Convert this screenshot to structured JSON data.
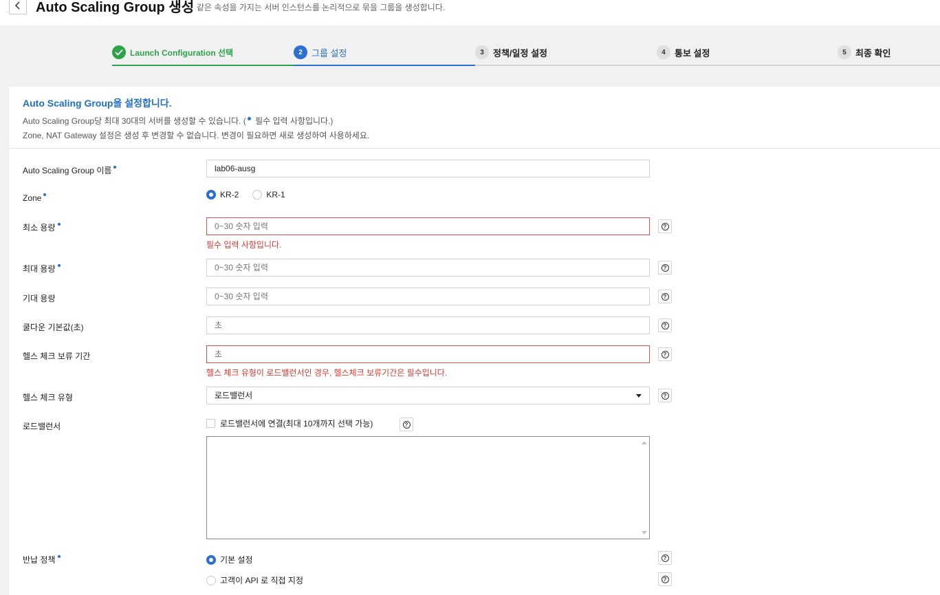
{
  "header": {
    "title": "Auto Scaling Group 생성",
    "description": "같은 속성을 가지는 서버 인스턴스를 논리적으로 묶을 그룹을 생성합니다."
  },
  "steps": [
    {
      "num": "",
      "label": "Launch Configuration 선택",
      "state": "done"
    },
    {
      "num": "2",
      "label": "그룹 설정",
      "state": "active"
    },
    {
      "num": "3",
      "label": "정책/일정 설정",
      "state": "todo"
    },
    {
      "num": "4",
      "label": "통보 설정",
      "state": "todo"
    },
    {
      "num": "5",
      "label": "최종 확인",
      "state": "todo"
    }
  ],
  "intro": {
    "title": "Auto Scaling Group을 설정합니다.",
    "line1_a": "Auto Scaling Group당 최대 30대의 서버를 생성할 수 있습니다. (",
    "line1_b": " 필수 입력 사항입니다.)",
    "line2": "Zone, NAT Gateway 설정은 생성 후 변경할 수 없습니다. 변경이 필요하면 새로 생성하여 사용하세요."
  },
  "form": {
    "name": {
      "label": "Auto Scaling Group 이름",
      "value": "lab06-ausg"
    },
    "zone": {
      "label": "Zone",
      "options": [
        "KR-2",
        "KR-1"
      ],
      "selected": "KR-2"
    },
    "min_capacity": {
      "label": "최소 용량",
      "placeholder": "0~30 숫자 입력",
      "error": "필수 입력 사항입니다."
    },
    "max_capacity": {
      "label": "최대 용량",
      "placeholder": "0~30 숫자 입력"
    },
    "desired_capacity": {
      "label": "기대 용량",
      "placeholder": "0~30 숫자 입력"
    },
    "cooldown": {
      "label": "쿨다운 기본값(초)",
      "placeholder": "초"
    },
    "health_grace": {
      "label": "헬스 체크 보류 기간",
      "placeholder": "초",
      "error": "헬스 체크 유형이 로드밸런서인 경우, 헬스체크 보류기간은 필수입니다."
    },
    "health_type": {
      "label": "헬스 체크 유형",
      "value": "로드밸런서"
    },
    "load_balancer": {
      "label": "로드밸런서",
      "checkbox_label": "로드밸런서에 연결(최대 10개까지 선택 가능)"
    },
    "return_policy": {
      "label": "반납 정책",
      "options": [
        "기본 설정",
        "고객이 API 로 직접 지정"
      ],
      "selected": "기본 설정"
    }
  },
  "colors": {
    "accent": "#2a6fd1",
    "done": "#2ca24a",
    "error": "#e0382f"
  }
}
